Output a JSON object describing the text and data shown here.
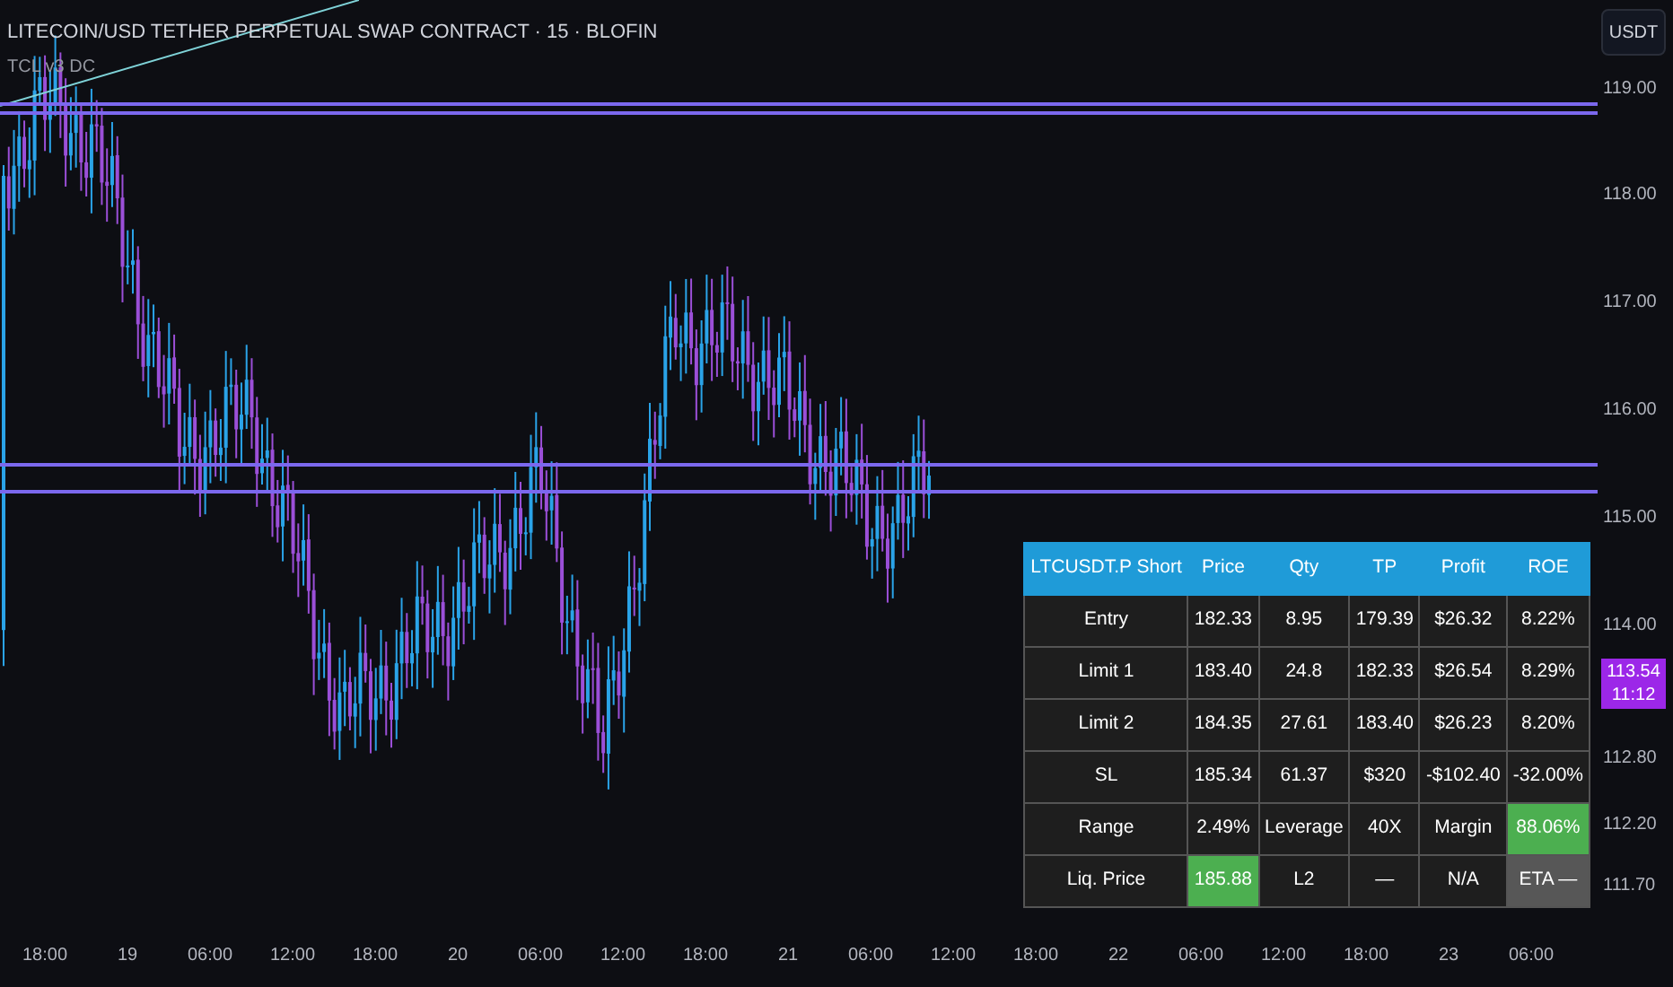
{
  "chart": {
    "title": "LITECOIN/USD TETHER PERPETUAL SWAP CONTRACT · 15 · BLOFIN",
    "indicator": "TCL v3 DC"
  },
  "currency_button": "USDT",
  "price_axis": [
    "119.00",
    "118.00",
    "117.00",
    "116.00",
    "115.00",
    "114.00",
    "112.80",
    "112.20",
    "111.70"
  ],
  "current_price": {
    "price": "113.54",
    "countdown": "11:12"
  },
  "time_axis": [
    "18:00",
    "19",
    "06:00",
    "12:00",
    "18:00",
    "20",
    "06:00",
    "12:00",
    "18:00",
    "21",
    "06:00",
    "12:00",
    "18:00",
    "22",
    "06:00",
    "12:00",
    "18:00",
    "23",
    "06:00"
  ],
  "table": {
    "columns": [
      "LTCUSDT.P Short",
      "Price",
      "Qty",
      "TP",
      "Profit",
      "ROE"
    ],
    "rows": [
      [
        {
          "text": "Entry"
        },
        {
          "text": "182.33"
        },
        {
          "text": "8.95"
        },
        {
          "text": "179.39"
        },
        {
          "text": "$26.32"
        },
        {
          "text": "8.22%"
        }
      ],
      [
        {
          "text": "Limit 1"
        },
        {
          "text": "183.40"
        },
        {
          "text": "24.8"
        },
        {
          "text": "182.33"
        },
        {
          "text": "$26.54"
        },
        {
          "text": "8.29%"
        }
      ],
      [
        {
          "text": "Limit 2"
        },
        {
          "text": "184.35"
        },
        {
          "text": "27.61"
        },
        {
          "text": "183.40"
        },
        {
          "text": "$26.23"
        },
        {
          "text": "8.20%"
        }
      ],
      [
        {
          "text": "SL"
        },
        {
          "text": "185.34"
        },
        {
          "text": "61.37"
        },
        {
          "text": "$320"
        },
        {
          "text": "-$102.40"
        },
        {
          "text": "-32.00%"
        }
      ],
      [
        {
          "text": "Range"
        },
        {
          "text": "2.49%"
        },
        {
          "text": "Leverage"
        },
        {
          "text": "40X"
        },
        {
          "text": "Margin"
        },
        {
          "text": "88.06%",
          "color": "#4caf50"
        }
      ],
      [
        {
          "text": "Liq. Price"
        },
        {
          "text": "185.88",
          "color": "#4caf50"
        },
        {
          "text": "L2"
        },
        {
          "text": "—"
        },
        {
          "text": "N/A"
        },
        {
          "text": "ETA —",
          "color": "#575757"
        }
      ]
    ]
  }
}
